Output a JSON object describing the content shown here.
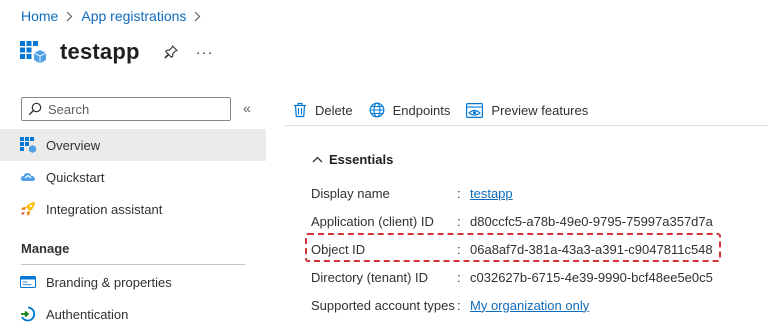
{
  "breadcrumb": [
    {
      "label": "Home"
    },
    {
      "label": "App registrations"
    }
  ],
  "header": {
    "title": "testapp",
    "more_label": "···"
  },
  "sidebar": {
    "search_placeholder": "Search",
    "collapse_label": "«",
    "items": [
      {
        "label": "Overview",
        "icon": "overview-grid-icon",
        "active": true
      },
      {
        "label": "Quickstart",
        "icon": "quickstart-cloud-icon"
      },
      {
        "label": "Integration assistant",
        "icon": "rocket-icon"
      }
    ],
    "manage_header": "Manage",
    "manage_items": [
      {
        "label": "Branding & properties",
        "icon": "branding-icon"
      },
      {
        "label": "Authentication",
        "icon": "authentication-icon"
      }
    ]
  },
  "toolbar": {
    "delete_label": "Delete",
    "endpoints_label": "Endpoints",
    "preview_label": "Preview features"
  },
  "essentials": {
    "label": "Essentials",
    "properties": [
      {
        "key": "Display name",
        "value": "testapp",
        "link": true
      },
      {
        "key": "Application (client) ID",
        "value": "d80ccfc5-a78b-49e0-9795-75997a357d7a",
        "link": false
      },
      {
        "key": "Object ID",
        "value": "06a8af7d-381a-43a3-a391-c9047811c548",
        "link": false,
        "highlighted": true
      },
      {
        "key": "Directory (tenant) ID",
        "value": "c032627b-6715-4e39-9990-bcf48ee5e0c5",
        "link": false
      },
      {
        "key": "Supported account types",
        "value": "My organization only",
        "link": true
      }
    ]
  },
  "colors": {
    "link": "#0f6cbd",
    "active_bg": "#edebe9",
    "highlight": "#d13438"
  }
}
